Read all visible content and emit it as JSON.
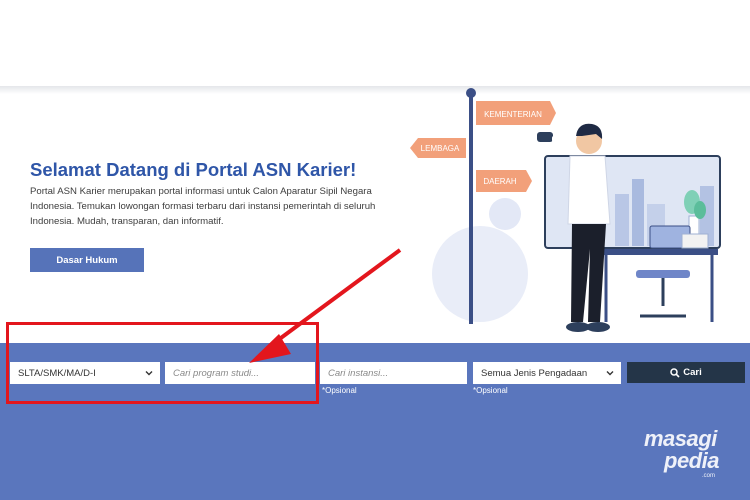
{
  "hero": {
    "title": "Selamat Datang di Portal ASN Karier!",
    "description": "Portal ASN Karier merupakan portal informasi untuk Calon Aparatur Sipil Negara Indonesia. Temukan lowongan formasi terbaru dari instansi pemerintah di seluruh Indonesia. Mudah, transparan, dan informatif.",
    "button_label": "Dasar Hukum"
  },
  "illustration": {
    "signs": [
      "KEMENTERIAN",
      "LEMBAGA",
      "DAERAH"
    ]
  },
  "search": {
    "education_value": "SLTA/SMK/MA/D-I",
    "program_placeholder": "Cari program studi...",
    "instansi_placeholder": "Cari instansi...",
    "instansi_hint": "*Opsional",
    "jenis_value": "Semua Jenis Pengadaan",
    "jenis_hint": "*Opsional",
    "button_label": "Cari"
  },
  "watermark": {
    "line1": "masagi",
    "line2": "pedia",
    "suffix": ".com"
  },
  "colors": {
    "title": "#2f56a8",
    "band": "#5a76bd",
    "button": "#5673b9",
    "search_button": "#243548",
    "annotation": "#e3161d",
    "sign": "#f2a07a"
  }
}
